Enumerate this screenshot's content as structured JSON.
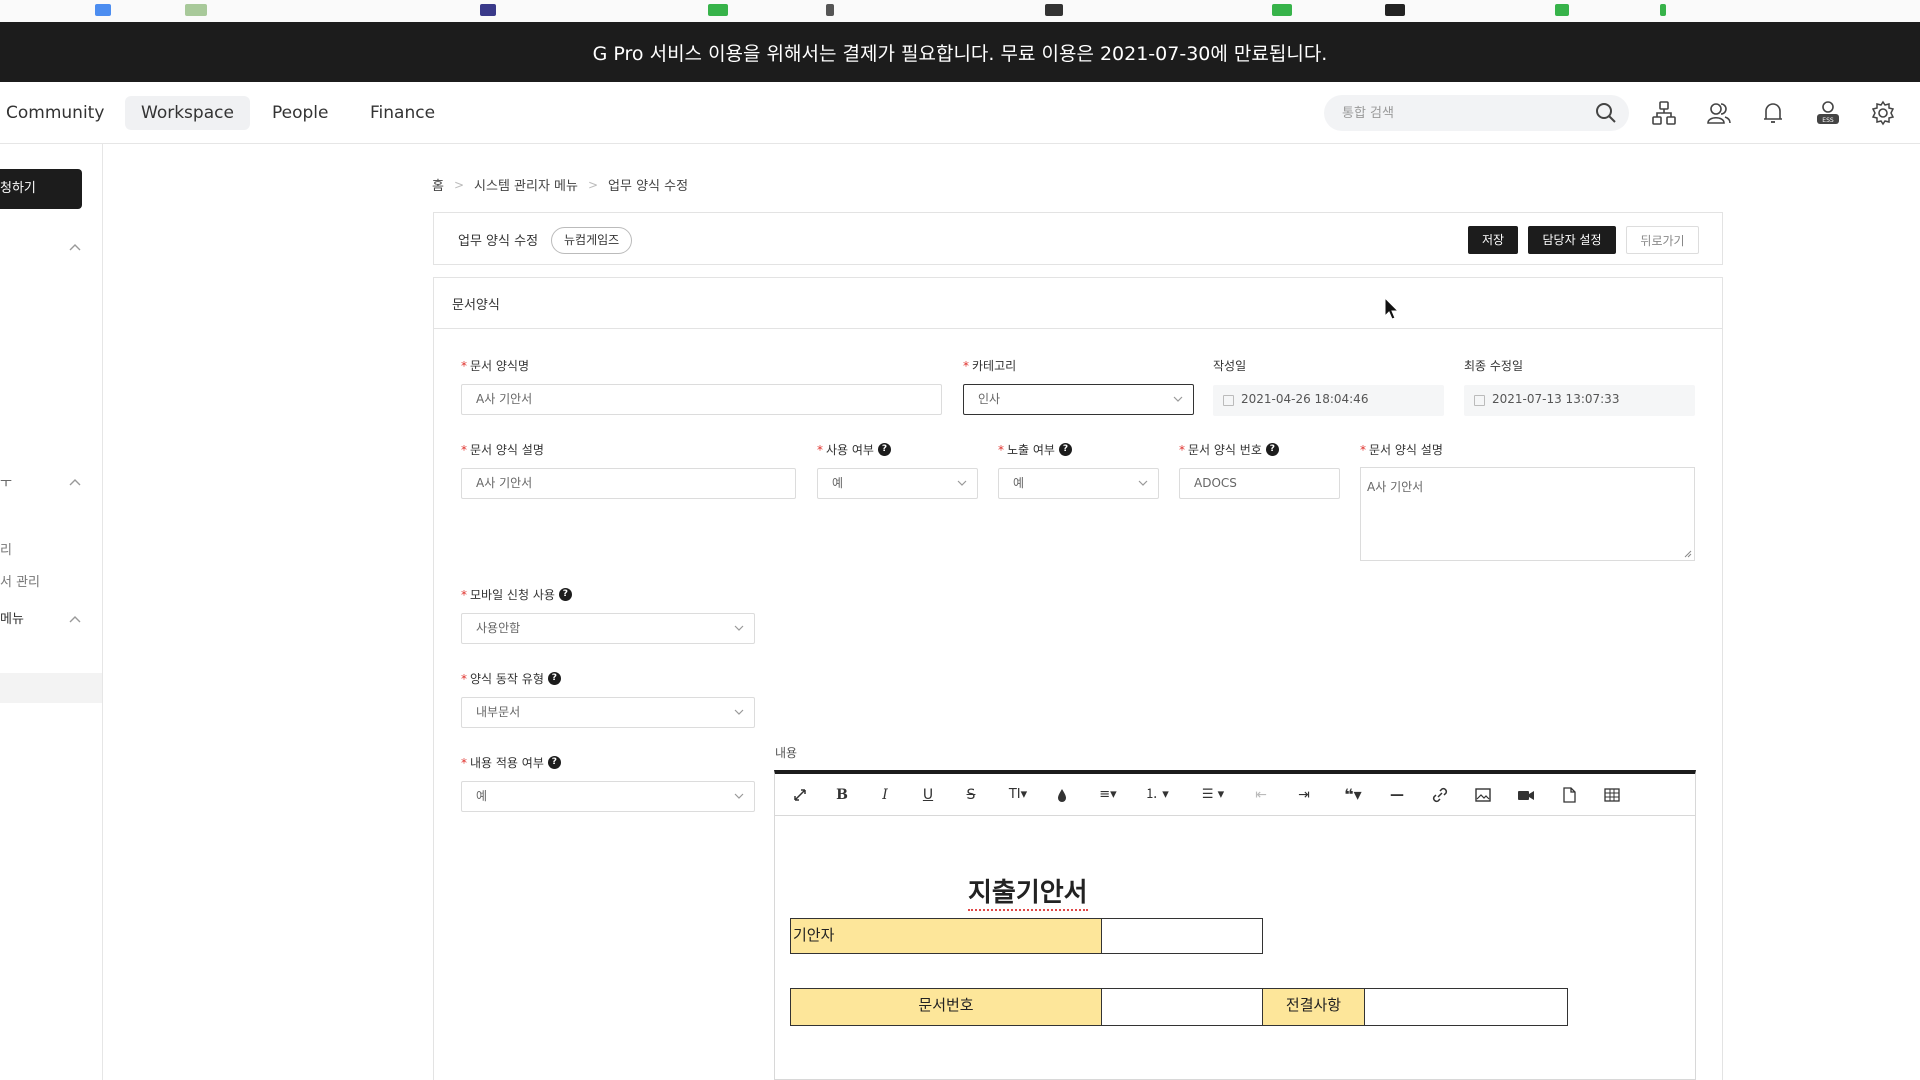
{
  "banner": {
    "text": "G Pro 서비스 이용을 위해서는 결제가 필요합니다. 무료 이용은 2021-07-30에 만료됩니다."
  },
  "nav": {
    "items": [
      "Community",
      "Workspace",
      "People",
      "Finance"
    ],
    "active": "Workspace",
    "search_placeholder": "통합 검색",
    "icons": [
      "org-chart-icon",
      "users-icon",
      "bell-icon",
      "ess-user-icon",
      "gear-icon"
    ]
  },
  "sidebar": {
    "button_label": "청하기",
    "items": [
      "ㅜ",
      "리",
      "서 관리",
      "메뉴"
    ]
  },
  "breadcrumb": [
    "홈",
    "시스템 관리자 메뉴",
    "업무 양식 수정"
  ],
  "title_bar": {
    "title": "업무 양식 수정",
    "badge": "뉴컴게임즈",
    "save": "저장",
    "assign": "담당자 설정",
    "back": "뒤로가기"
  },
  "form": {
    "section_title": "문서양식",
    "doc_name_label": "문서 양식명",
    "doc_name_value": "A사 기안서",
    "category_label": "카테고리",
    "category_value": "인사",
    "created_label": "작성일",
    "created_value": "2021-04-26 18:04:46",
    "modified_label": "최종 수정일",
    "modified_value": "2021-07-13 13:07:33",
    "desc_label": "문서 양식 설명",
    "desc_value": "A사 기안서",
    "use_label": "사용 여부",
    "use_value": "예",
    "expose_label": "노출 여부",
    "expose_value": "예",
    "number_label": "문서 양식 번호",
    "number_value": "ADOCS",
    "desc2_label": "문서 양식 설명",
    "desc2_value": "A사 기안서",
    "mobile_label": "모바일 신청 사용",
    "mobile_value": "사용안함",
    "action_label": "양식 동작 유형",
    "action_value": "내부문서",
    "content_apply_label": "내용 적용 여부",
    "content_apply_value": "예",
    "content_label": "내용"
  },
  "editor": {
    "doc_title": "지출기안서",
    "drafter_label": "기안자",
    "doc_number_label": "문서번호",
    "delegation_label": "전결사항"
  },
  "colors": {
    "dark": "#1c1c1c",
    "highlight": "#fde69a",
    "required": "#e0332e"
  }
}
